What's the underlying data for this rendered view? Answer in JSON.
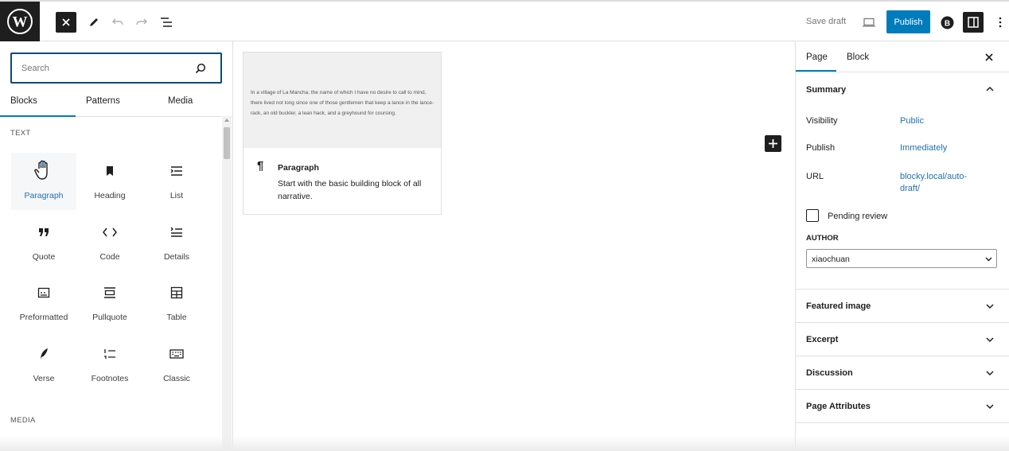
{
  "toolbar": {
    "save_draft": "Save draft",
    "publish": "Publish"
  },
  "inserter": {
    "search_placeholder": "Search",
    "tabs": [
      "Blocks",
      "Patterns",
      "Media"
    ],
    "categories": {
      "text": "TEXT",
      "media": "MEDIA"
    },
    "blocks": [
      {
        "label": "Paragraph",
        "icon": "hand-cursor-icon"
      },
      {
        "label": "Heading",
        "icon": "bookmark-icon"
      },
      {
        "label": "List",
        "icon": "list-icon"
      },
      {
        "label": "Quote",
        "icon": "quote-icon"
      },
      {
        "label": "Code",
        "icon": "code-icon"
      },
      {
        "label": "Details",
        "icon": "details-icon"
      },
      {
        "label": "Preformatted",
        "icon": "preformatted-icon"
      },
      {
        "label": "Pullquote",
        "icon": "pullquote-icon"
      },
      {
        "label": "Table",
        "icon": "table-icon"
      },
      {
        "label": "Verse",
        "icon": "feather-icon"
      },
      {
        "label": "Footnotes",
        "icon": "footnotes-icon"
      },
      {
        "label": "Classic",
        "icon": "keyboard-icon"
      }
    ]
  },
  "preview": {
    "sample_text": "In a village of La Mancha, the name of which I have no desire to call to mind, there lived not long since one of those gentlemen that keep a lance in the lance-rack, an old buckler, a lean hack, and a greyhound for coursing.",
    "title": "Paragraph",
    "description": "Start with the basic building block of all narrative."
  },
  "sidebar": {
    "tabs": [
      "Page",
      "Block"
    ],
    "summary": {
      "heading": "Summary",
      "visibility_label": "Visibility",
      "visibility_value": "Public",
      "publish_label": "Publish",
      "publish_value": "Immediately",
      "url_label": "URL",
      "url_value": "blocky.local/auto-draft/",
      "pending_review": "Pending review",
      "author_label": "AUTHOR",
      "author_value": "xiaochuan"
    },
    "panels": [
      "Featured image",
      "Excerpt",
      "Discussion",
      "Page Attributes"
    ]
  },
  "colors": {
    "accent": "#007cba",
    "dark": "#1e1e1e"
  }
}
